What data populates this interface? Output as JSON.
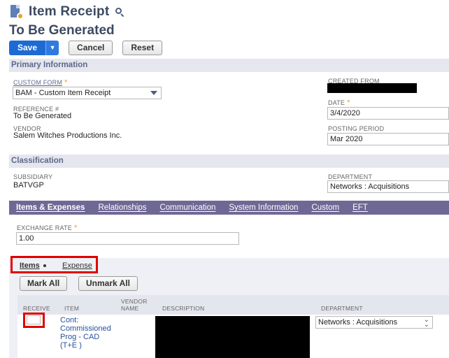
{
  "header": {
    "page_title": "Item Receipt",
    "record_name": "To Be Generated"
  },
  "buttons": {
    "save": "Save",
    "save_arrow": "▼",
    "cancel": "Cancel",
    "reset": "Reset"
  },
  "primary": {
    "section_title": "Primary Information",
    "custom_form_label": "CUSTOM FORM",
    "custom_form_value": "BAM - Custom Item Receipt",
    "reference_label": "REFERENCE #",
    "reference_value": "To Be Generated",
    "vendor_label": "VENDOR",
    "vendor_value": "Salem Witches Productions Inc.",
    "created_from_label": "CREATED FROM",
    "date_label": "DATE",
    "date_value": "3/4/2020",
    "posting_period_label": "POSTING PERIOD",
    "posting_period_value": "Mar 2020",
    "required_mark": "*"
  },
  "classification": {
    "section_title": "Classification",
    "subsidiary_label": "SUBSIDIARY",
    "subsidiary_value": "BATVGP",
    "department_label": "DEPARTMENT",
    "department_value": "Networks : Acquisitions"
  },
  "tabs": [
    {
      "label": "Items & Expenses"
    },
    {
      "label": "Relationships"
    },
    {
      "label": "Communication"
    },
    {
      "label": "System Information"
    },
    {
      "label": "Custom"
    },
    {
      "label": "EFT"
    }
  ],
  "items_tab": {
    "exchange_rate_label": "EXCHANGE RATE",
    "exchange_rate_value": "1.00",
    "subtab_items": "Items",
    "subtab_expense": "Expense",
    "mark_all": "Mark All",
    "unmark_all": "Unmark All",
    "columns": {
      "receive": "RECEIVE",
      "item": "ITEM",
      "vendor_name_1": "VENDOR",
      "vendor_name_2": "NAME",
      "description": "DESCRIPTION",
      "department": "DEPARTMENT"
    },
    "row": {
      "item_lines": [
        "Cont:",
        "Commissioned",
        "Prog - CAD",
        "(T+E )"
      ],
      "department": "Networks : Acquisitions"
    }
  },
  "colors": {
    "primary_button": "#1e6ad4",
    "tab_bar": "#6e6994",
    "section_header": "#e5e6ee",
    "highlight_box": "#e00000",
    "title_text": "#3d4a63"
  }
}
